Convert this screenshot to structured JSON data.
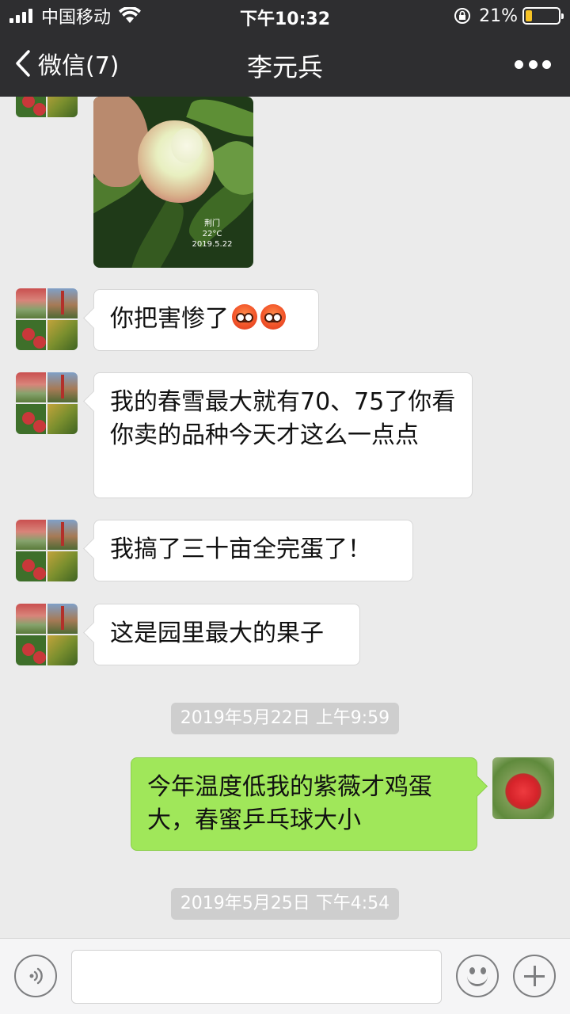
{
  "status_bar": {
    "carrier": "中国移动",
    "time": "下午10:32",
    "battery_percent": "21%",
    "battery_level": 0.21
  },
  "nav": {
    "back_label": "微信(7)",
    "title": "李元兵",
    "more_icon": "more-dots-icon"
  },
  "photo": {
    "watermark_place": "荆门",
    "watermark_temp": "22°C",
    "watermark_date": "2019.5.22"
  },
  "messages": [
    {
      "side": "left",
      "text": "你把害惨了"
    },
    {
      "side": "left",
      "text": "我的春雪最大就有70、75了你看你卖的品种今天才这么一点点"
    },
    {
      "side": "left",
      "text": "我搞了三十亩全完蛋了！"
    },
    {
      "side": "left",
      "text": "这是园里最大的果子"
    },
    {
      "side": "right",
      "text": "今年温度低我的紫薇才鸡蛋大，春蜜乒乓球大小"
    }
  ],
  "timestamps": [
    "2019年5月22日 上午9:59",
    "2019年5月25日 下午4:54"
  ],
  "input": {
    "value": "",
    "placeholder": ""
  },
  "colors": {
    "header": "#2e2e30",
    "chat_bg": "#ebebeb",
    "outgoing_bubble": "#a0e75a",
    "timestamp_bg": "#cecece"
  }
}
